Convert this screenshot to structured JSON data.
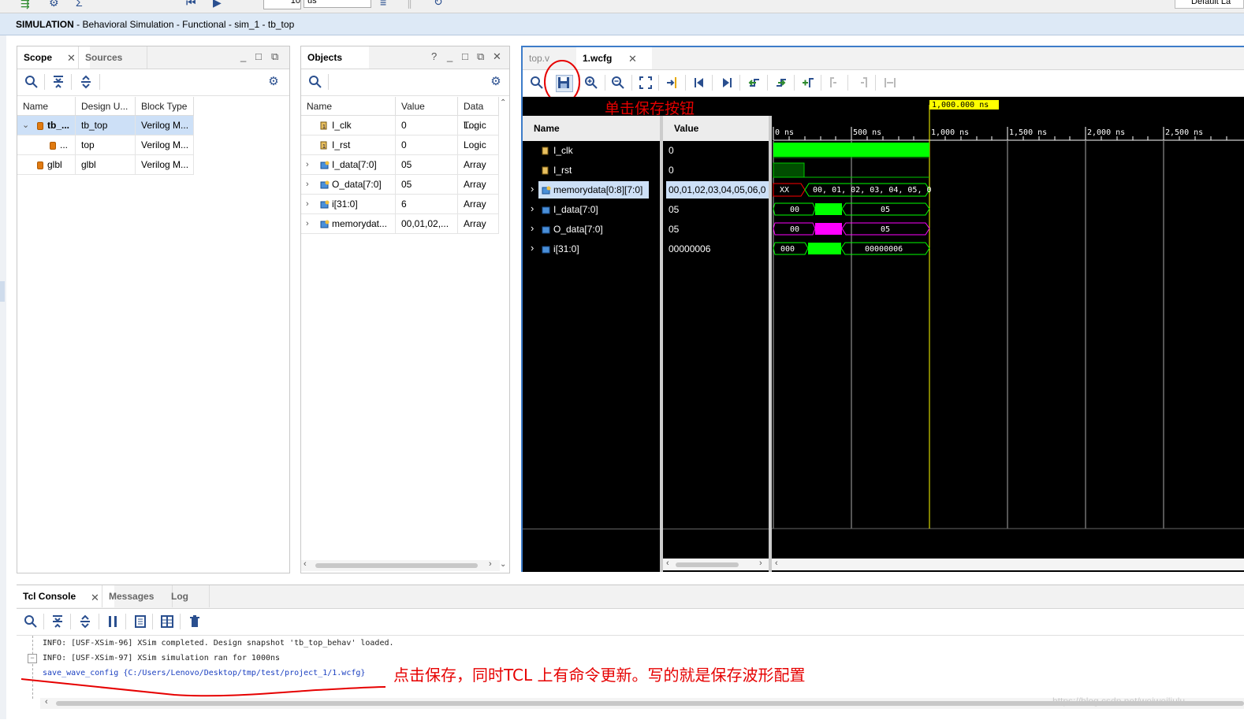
{
  "toolbar_top": {
    "run_time_value": "10",
    "run_time_unit": "us",
    "layout_label": "Default La"
  },
  "sim_bar": {
    "bold": "SIMULATION",
    "rest": " - Behavioral Simulation - Functional - sim_1 - tb_top"
  },
  "scope_panel": {
    "tabs": [
      "Scope",
      "Sources"
    ],
    "columns": [
      "Name",
      "Design U...",
      "Block Type"
    ],
    "rows": [
      {
        "name": "tb_...",
        "design": "tb_top",
        "block": "Verilog M..."
      },
      {
        "name": "...",
        "design": "top",
        "block": "Verilog M..."
      },
      {
        "name": "glbl",
        "design": "glbl",
        "block": "Verilog M..."
      }
    ]
  },
  "objects_panel": {
    "title": "Objects",
    "help": "?",
    "columns": [
      "Name",
      "Value",
      "Data T..."
    ],
    "rows": [
      {
        "name": "I_clk",
        "value": "0",
        "type": "Logic"
      },
      {
        "name": "I_rst",
        "value": "0",
        "type": "Logic"
      },
      {
        "name": "I_data[7:0]",
        "value": "05",
        "type": "Array"
      },
      {
        "name": "O_data[7:0]",
        "value": "05",
        "type": "Array"
      },
      {
        "name": "i[31:0]",
        "value": "6",
        "type": "Array"
      },
      {
        "name": "memorydat...",
        "value": "00,01,02,...",
        "type": "Array"
      }
    ]
  },
  "wave_panel": {
    "tabs": [
      "top.v",
      "1.wcfg"
    ],
    "annotation_save": "单击保存按钮",
    "cursor_label": "1,000.000 ns",
    "name_header": "Name",
    "value_header": "Value",
    "signals": [
      {
        "name": "I_clk",
        "value": "0"
      },
      {
        "name": "I_rst",
        "value": "0"
      },
      {
        "name": "memorydata[0:8][7:0]",
        "value": "00,01,02,03,04,05,06,0"
      },
      {
        "name": "I_data[7:0]",
        "value": "05"
      },
      {
        "name": "O_data[7:0]",
        "value": "05"
      },
      {
        "name": "i[31:0]",
        "value": "00000006"
      }
    ],
    "ruler": [
      "0 ns",
      "500 ns",
      "1,000 ns",
      "1,500 ns",
      "2,000 ns",
      "2,500 ns"
    ],
    "bus_labels": {
      "mem_a": "XX",
      "mem_b": "00, 01, 02, 03, 04, 05, 0",
      "idata_a": "00",
      "idata_b": "05",
      "odata_a": "00",
      "odata_b": "05",
      "i_a": "000",
      "i_b": "00000006"
    },
    "colors": {
      "clk": "#00ff00",
      "mem_xx": "#ff0000",
      "odata": "#ff00ff",
      "cursor": "#ffff00"
    }
  },
  "console_panel": {
    "tabs": [
      "Tcl Console",
      "Messages",
      "Log"
    ],
    "lines": [
      "INFO: [USF-XSim-96] XSim completed. Design snapshot 'tb_top_behav' loaded.",
      "INFO: [USF-XSim-97] XSim simulation ran for 1000ns",
      "save_wave_config {C:/Users/Lenovo/Desktop/tmp/test/project_1/1.wcfg}"
    ],
    "annotation": "点击保存，同时TCL 上有命令更新。写的就是保存波形配置"
  },
  "watermark": "https://blog.csdn.net/weiweiliulu"
}
